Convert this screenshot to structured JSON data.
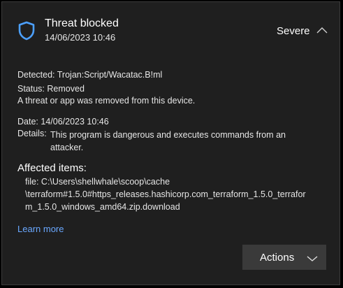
{
  "notification": {
    "title": "Threat blocked",
    "timestamp": "14/06/2023 10:46",
    "severity": "Severe"
  },
  "threat": {
    "detected_label": "Detected:",
    "detected_value": "Trojan:Script/Wacatac.B!ml",
    "status_label": "Status:",
    "status_value": "Removed",
    "description": "A threat or app was removed from this device.",
    "date_label": "Date:",
    "date_value": "14/06/2023 10:46",
    "details_label": "Details:",
    "details_value": "This program is dangerous and executes commands from an attacker."
  },
  "affected": {
    "title": "Affected items:",
    "lines": [
      "file: C:\\Users\\shellwhale\\scoop\\cache",
      "\\terraform#1.5.0#https_releases.hashicorp.com_terraform_1.5.0_terrafor",
      "m_1.5.0_windows_amd64.zip.download"
    ]
  },
  "links": {
    "learn_more": "Learn more"
  },
  "actions": {
    "label": "Actions"
  },
  "colors": {
    "card_background": "#1f1f1f",
    "shield_accent": "#4ca0ff",
    "link": "#6aa8ff",
    "button_background": "#3a3a3a"
  },
  "icons": {
    "shield": "shield-icon",
    "collapse": "chevron-up-icon",
    "expand": "chevron-down-icon"
  }
}
